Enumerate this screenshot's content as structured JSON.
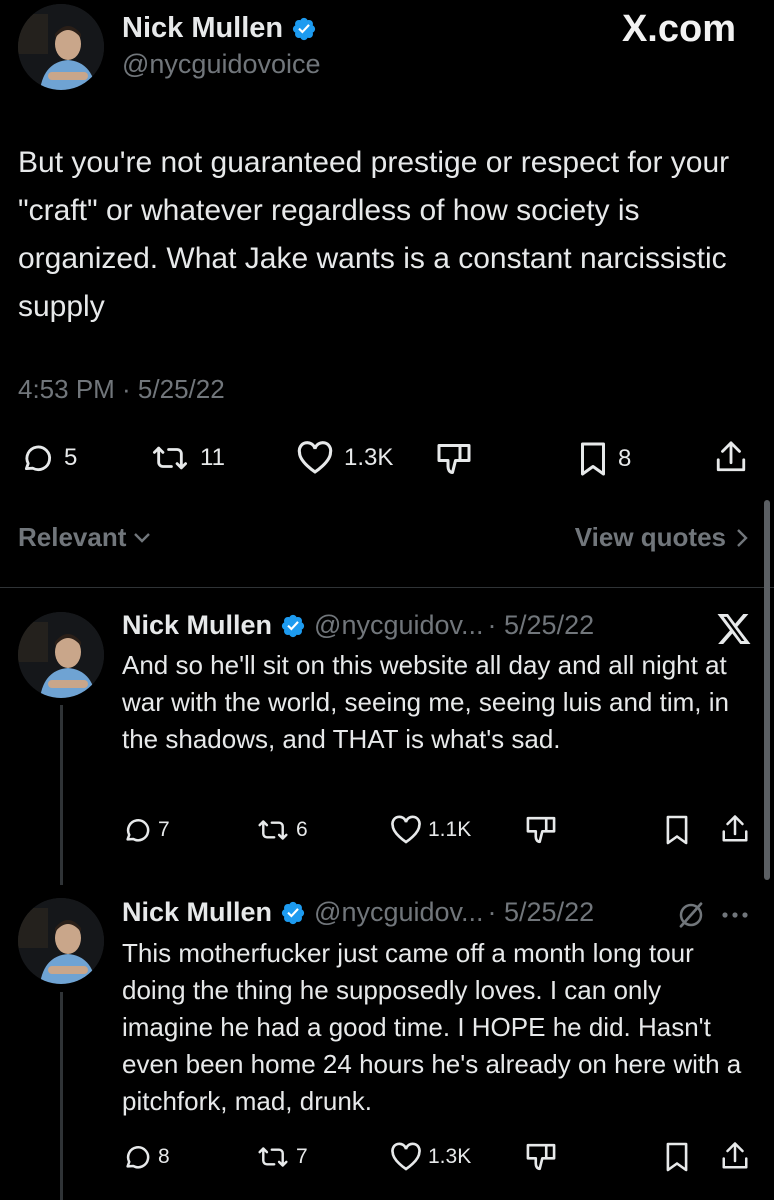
{
  "main_tweet": {
    "author": {
      "name": "Nick Mullen",
      "handle": "@nycguidovoice"
    },
    "brand": "X.com",
    "text": "But you're not guaranteed prestige or respect for your \"craft\" or whatever regardless of how society is organized. What Jake wants is a constant narcissistic supply",
    "timestamp": "4:53 PM · 5/25/22",
    "stats": {
      "replies": "5",
      "reposts": "11",
      "likes": "1.3K",
      "bookmarks": "8"
    }
  },
  "sort": {
    "label": "Relevant",
    "view_quotes": "View quotes"
  },
  "replies": [
    {
      "name": "Nick Mullen",
      "handle": "@nycguidov...",
      "date": "· 5/25/22",
      "text": "And so he'll sit on this website all day and all night at war with the world, seeing me, seeing luis and tim, in the shadows, and THAT is what's sad.",
      "stats": {
        "replies": "7",
        "reposts": "6",
        "likes": "1.1K"
      }
    },
    {
      "name": "Nick Mullen",
      "handle": "@nycguidov...",
      "date": "· 5/25/22",
      "text": "This motherfucker just came off a month long tour doing the thing he supposedly loves. I can only imagine he had a good time. I HOPE he did. Hasn't even been home 24 hours he's already on here with a pitchfork, mad, drunk.",
      "stats": {
        "replies": "8",
        "reposts": "7",
        "likes": "1.3K"
      }
    }
  ],
  "colors": {
    "background": "#000000",
    "text": "#e7e9ea",
    "secondary": "#71767b",
    "verified": "#1d9bf0"
  }
}
